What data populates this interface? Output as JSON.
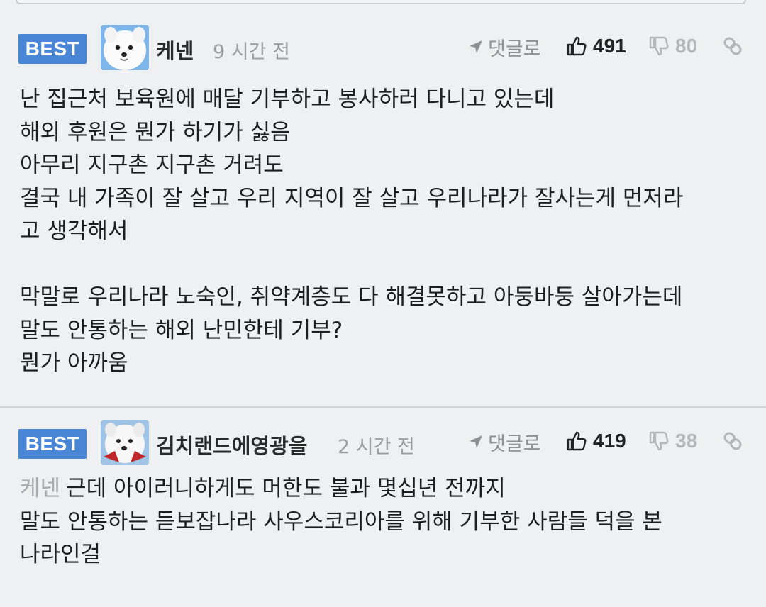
{
  "comments": [
    {
      "badge": "BEST",
      "username": "케넨",
      "time": "9 시간 전",
      "reply_label": "댓글로",
      "likes": "491",
      "dislikes": "80",
      "lines": [
        "난 집근처 보육원에 매달 기부하고 봉사하러 다니고 있는데",
        "해외 후원은 뭔가 하기가 싫음",
        "아무리 지구촌 지구촌 거려도",
        "결국 내 가족이 잘 살고 우리 지역이 잘 살고 우리나라가 잘사는게 먼저라",
        "고 생각해서",
        "",
        "막말로 우리나라 노숙인, 취약계층도 다 해결못하고 아둥바둥 살아가는데",
        "말도 안통하는 해외 난민한테 기부?",
        "뭔가 아까움"
      ]
    },
    {
      "badge": "BEST",
      "username": "김치랜드에영광을",
      "time": "2 시간 전",
      "reply_label": "댓글로",
      "likes": "419",
      "dislikes": "38",
      "mention": "케넨",
      "lines": [
        "근데 아이러니하게도 머한도 불과 몇십년 전까지",
        "말도 안통하는 듣보잡나라 사우스코리아를 위해 기부한 사람들 덕을 본",
        "나라인걸"
      ]
    }
  ],
  "icons": {
    "reply": "arrow-pointer-icon",
    "like": "thumbs-up-icon",
    "dislike": "thumbs-down-icon",
    "link": "link-icon",
    "avatar": "white-dog-avatar"
  },
  "colors": {
    "badge": "#4a86d6",
    "background": "#eef0f2",
    "muted": "#9a9da1"
  }
}
